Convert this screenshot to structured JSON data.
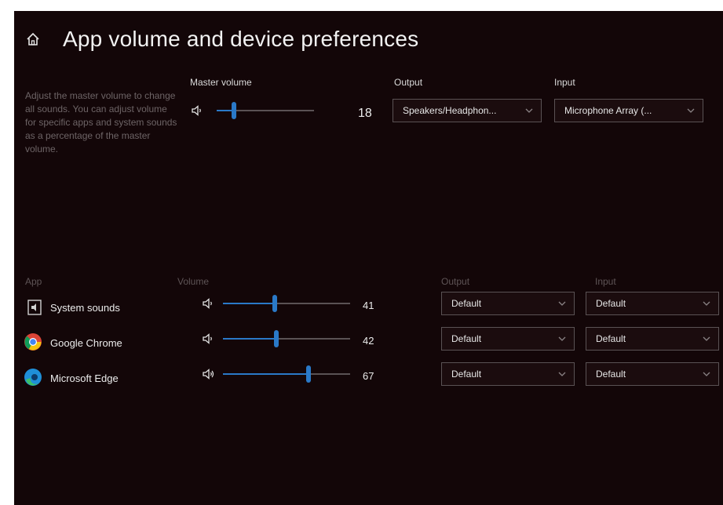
{
  "header": {
    "title": "App volume and device preferences",
    "home_icon": "home-icon"
  },
  "description": "Adjust the master volume to change all sounds. You can adjust volume for specific apps and system sounds as a percentage of the master volume.",
  "master": {
    "label": "Master volume",
    "value": "18",
    "level": 0.18,
    "output_label": "Output",
    "output_value": "Speakers/Headphon...",
    "input_label": "Input",
    "input_value": "Microphone Array (..."
  },
  "columns": {
    "app": "App",
    "volume": "Volume",
    "output": "Output",
    "input": "Input"
  },
  "apps": [
    {
      "name": "System sounds",
      "icon": "system-sounds-icon",
      "value": "41",
      "level": 0.41,
      "output": "Default",
      "input": "Default"
    },
    {
      "name": "Google Chrome",
      "icon": "chrome-icon",
      "value": "42",
      "level": 0.42,
      "output": "Default",
      "input": "Default"
    },
    {
      "name": "Microsoft Edge",
      "icon": "edge-icon",
      "value": "67",
      "level": 0.67,
      "output": "Default",
      "input": "Default"
    }
  ],
  "colors": {
    "background": "#130608",
    "accent": "#2a79c8",
    "text": "#e6e6e6"
  }
}
